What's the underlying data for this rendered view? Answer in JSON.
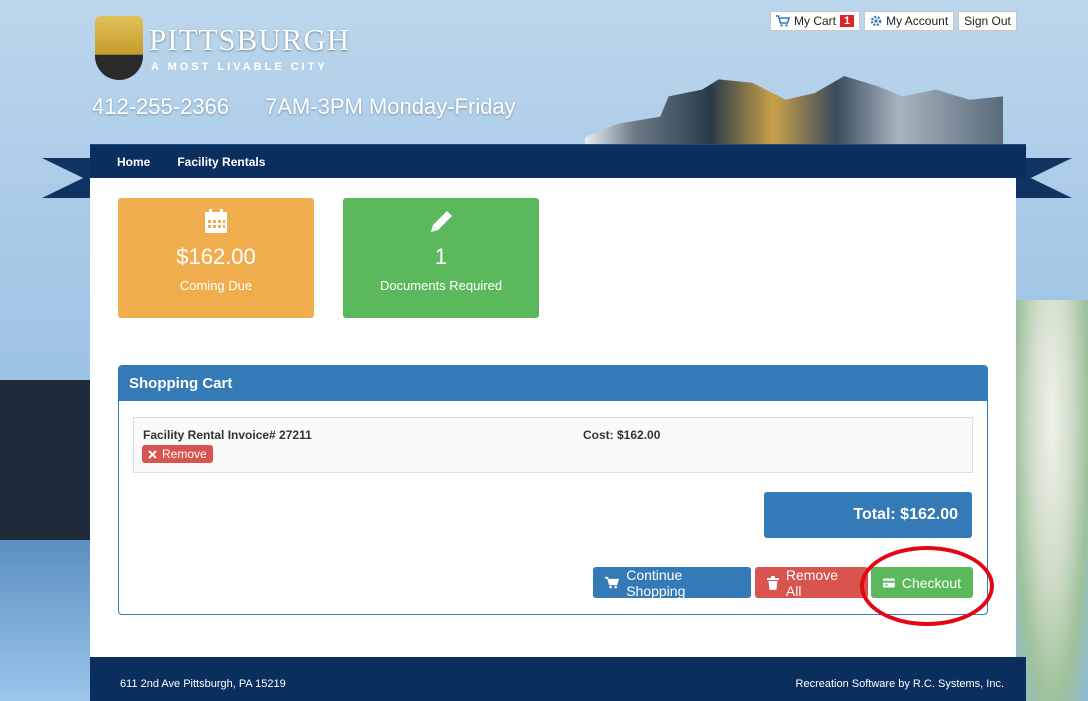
{
  "header": {
    "logo_title": "PITTSBURGH",
    "logo_subtitle": "A MOST LIVABLE CITY",
    "phone": "412-255-2366",
    "hours": "7AM-3PM Monday-Friday"
  },
  "top_links": {
    "cart_label": "My Cart",
    "cart_count": "1",
    "account_label": "My Account",
    "signout_label": "Sign Out"
  },
  "nav": {
    "items": [
      {
        "label": "Home"
      },
      {
        "label": "Facility Rentals"
      }
    ]
  },
  "tiles": {
    "coming_due": {
      "value": "$162.00",
      "label": "Coming Due",
      "icon": "calendar-icon",
      "color": "#f0ad4e"
    },
    "documents": {
      "value": "1",
      "label": "Documents Required",
      "icon": "pencil-icon",
      "color": "#5cb85c"
    }
  },
  "cart": {
    "title": "Shopping Cart",
    "items": [
      {
        "name": "Facility Rental Invoice# 27211",
        "cost": "Cost: $162.00",
        "remove_label": "Remove"
      }
    ],
    "total": "Total: $162.00",
    "buttons": {
      "continue": "Continue Shopping",
      "remove_all": "Remove All",
      "checkout": "Checkout"
    }
  },
  "footer": {
    "address": "611 2nd Ave Pittsburgh, PA 15219",
    "credit": "Recreation Software by R.C. Systems, Inc."
  },
  "colors": {
    "primary": "#337ab7",
    "navy": "#0a2f5e",
    "success": "#5cb85c",
    "warning": "#f0ad4e",
    "danger": "#d9534f",
    "highlight": "#e30613"
  }
}
